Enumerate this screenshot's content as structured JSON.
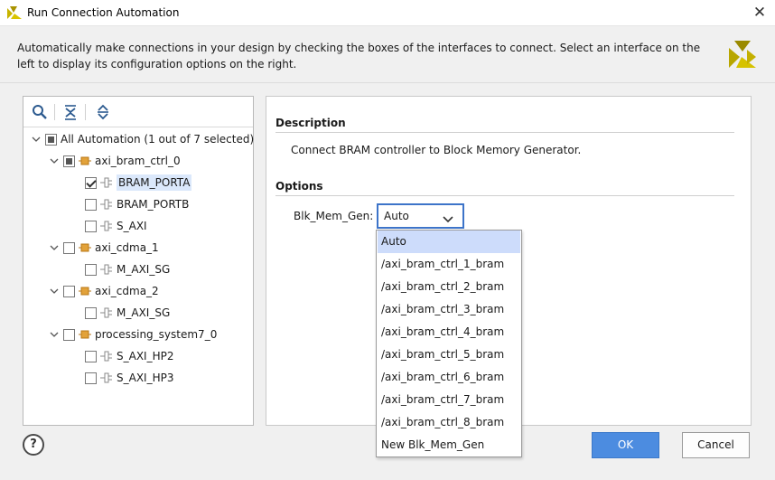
{
  "window": {
    "title": "Run Connection Automation",
    "close_glyph": "✕"
  },
  "intro": {
    "text": "Automatically make connections in your design by checking the boxes of the interfaces to connect. Select an interface on the left to display its configuration options on the right."
  },
  "toolbar": {
    "icons": [
      "search-icon",
      "collapse-all-icon",
      "expand-all-icon"
    ]
  },
  "tree": {
    "root": {
      "label": "All Automation (1 out of 7 selected)",
      "state": "partial"
    },
    "groups": [
      {
        "label": "axi_bram_ctrl_0",
        "state": "partial",
        "children": [
          {
            "label": "BRAM_PORTA",
            "checked": true,
            "selected": true
          },
          {
            "label": "BRAM_PORTB",
            "checked": false
          },
          {
            "label": "S_AXI",
            "checked": false
          }
        ]
      },
      {
        "label": "axi_cdma_1",
        "state": "unchecked",
        "children": [
          {
            "label": "M_AXI_SG",
            "checked": false
          }
        ]
      },
      {
        "label": "axi_cdma_2",
        "state": "unchecked",
        "children": [
          {
            "label": "M_AXI_SG",
            "checked": false
          }
        ]
      },
      {
        "label": "processing_system7_0",
        "state": "unchecked",
        "children": [
          {
            "label": "S_AXI_HP2",
            "checked": false
          },
          {
            "label": "S_AXI_HP3",
            "checked": false
          }
        ]
      }
    ]
  },
  "detail": {
    "description_title": "Description",
    "description_text": "Connect BRAM controller to Block Memory Generator.",
    "options_title": "Options",
    "field_label": "Blk_Mem_Gen:",
    "field_value": "Auto",
    "dropdown_options": [
      "Auto",
      "/axi_bram_ctrl_1_bram",
      "/axi_bram_ctrl_2_bram",
      "/axi_bram_ctrl_3_bram",
      "/axi_bram_ctrl_4_bram",
      "/axi_bram_ctrl_5_bram",
      "/axi_bram_ctrl_6_bram",
      "/axi_bram_ctrl_7_bram",
      "/axi_bram_ctrl_8_bram",
      "New Blk_Mem_Gen"
    ],
    "selected_option_index": 0
  },
  "footer": {
    "help_label": "?",
    "ok_label": "OK",
    "cancel_label": "Cancel"
  },
  "colors": {
    "accent": "#4c8ce0",
    "selection": "#cddcfb",
    "focus_border": "#3d74c9"
  }
}
